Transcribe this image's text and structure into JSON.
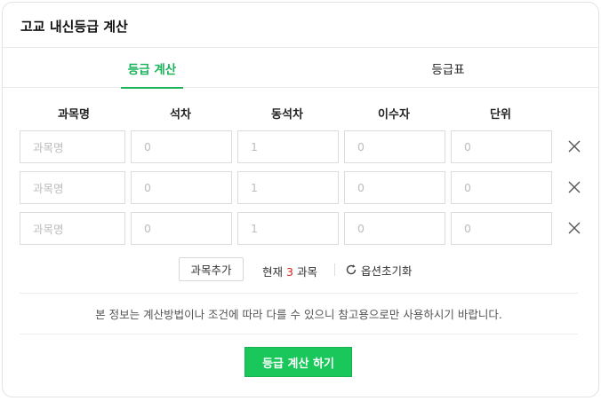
{
  "header": {
    "title": "고교 내신등급 계산"
  },
  "tabs": [
    {
      "label": "등급 계산",
      "active": true
    },
    {
      "label": "등급표",
      "active": false
    }
  ],
  "columns": [
    "과목명",
    "석차",
    "동석차",
    "이수자",
    "단위"
  ],
  "rows": [
    {
      "subject_placeholder": "과목명",
      "rank": "0",
      "tie": "1",
      "students": "0",
      "units": "0"
    },
    {
      "subject_placeholder": "과목명",
      "rank": "0",
      "tie": "1",
      "students": "0",
      "units": "0"
    },
    {
      "subject_placeholder": "과목명",
      "rank": "0",
      "tie": "1",
      "students": "0",
      "units": "0"
    }
  ],
  "controls": {
    "add_label": "과목추가",
    "count_prefix": "현재",
    "count_value": "3",
    "count_suffix": "과목",
    "reset_label": "옵션초기화"
  },
  "notice": "본 정보는 계산방법이나 조건에 따라 다를 수 있으니 참고용으로만 사용하시기 바랍니다.",
  "submit_label": "등급 계산 하기",
  "colors": {
    "accent": "#19c75a",
    "count": "#e02020"
  },
  "icons": {
    "delete": "close-icon",
    "reset": "refresh-icon"
  }
}
